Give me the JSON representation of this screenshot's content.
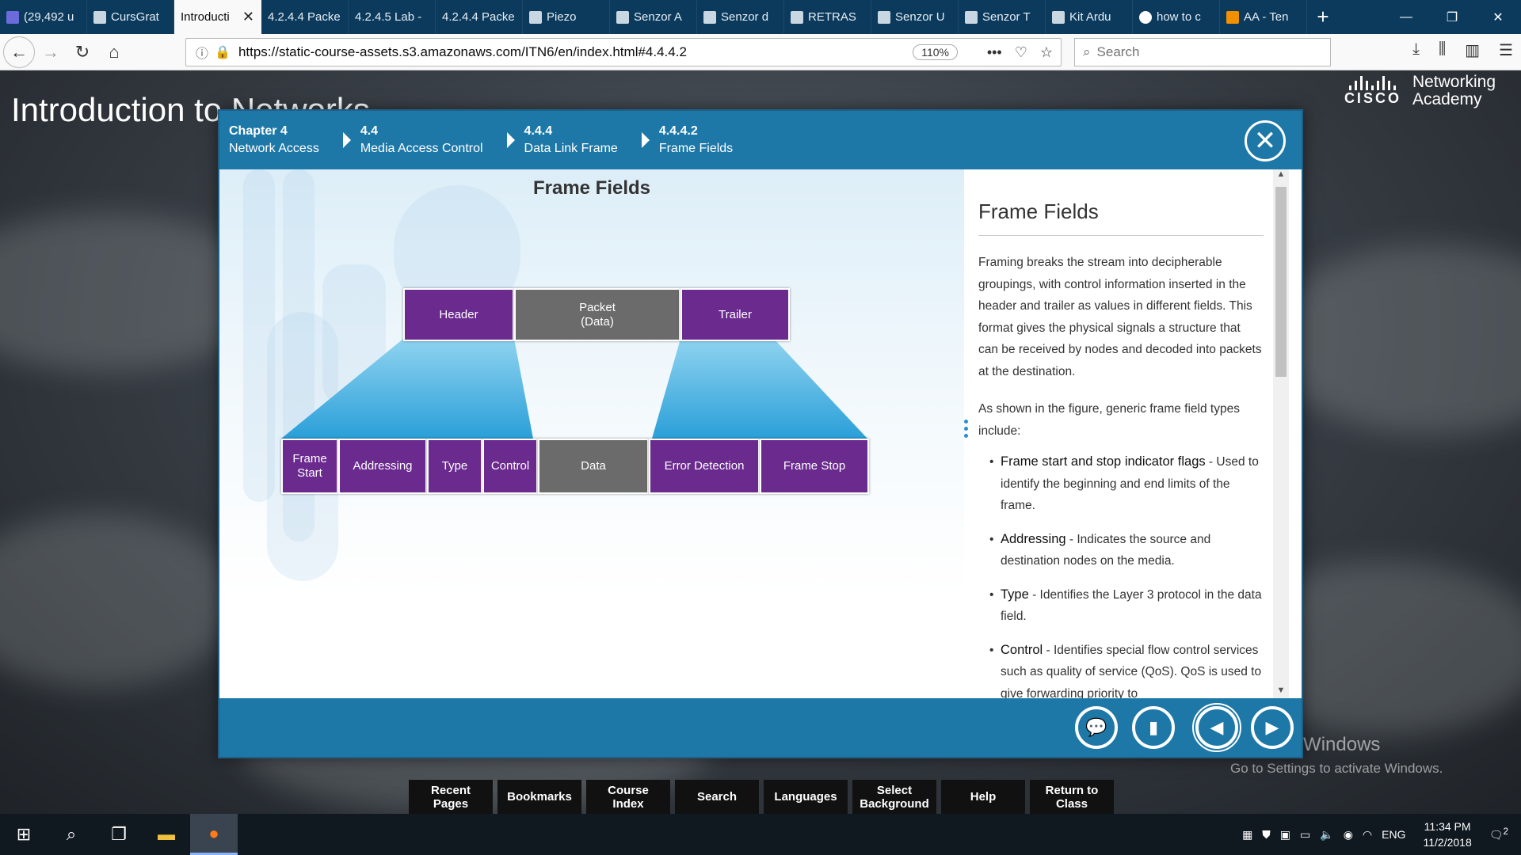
{
  "browser": {
    "tabs": [
      {
        "label": "(29,492 u",
        "icon": "mail-icon"
      },
      {
        "label": "CursGrat",
        "icon": "image-icon"
      },
      {
        "label": "Introducti",
        "icon": "none",
        "active": true
      },
      {
        "label": "4.2.4.4 Packe",
        "icon": "none"
      },
      {
        "label": "4.2.4.5 Lab -",
        "icon": "none"
      },
      {
        "label": "4.2.4.4 Packe",
        "icon": "none"
      },
      {
        "label": "Piezo",
        "icon": "image-icon"
      },
      {
        "label": "Senzor A",
        "icon": "image-icon"
      },
      {
        "label": "Senzor d",
        "icon": "image-icon"
      },
      {
        "label": "RETRAS",
        "icon": "image-icon"
      },
      {
        "label": "Senzor U",
        "icon": "image-icon"
      },
      {
        "label": "Senzor T",
        "icon": "image-icon"
      },
      {
        "label": "Kit Ardu",
        "icon": "image-icon"
      },
      {
        "label": "how to c",
        "icon": "google-icon"
      },
      {
        "label": "AA - Ten",
        "icon": "aa-icon"
      }
    ],
    "new_tab": "+",
    "url": "https://static-course-assets.s3.amazonaws.com/ITN6/en/index.html#4.4.4.2",
    "zoom": "110%",
    "search_placeholder": "Search"
  },
  "page": {
    "title": "Introduction to Networks",
    "brand_word": "CISCO",
    "brand_line1": "Networking",
    "brand_line2": "Academy",
    "activate_line1": "Activate Windows",
    "activate_line2": "Go to Settings to activate Windows."
  },
  "modal": {
    "breadcrumb": [
      {
        "num": "Chapter 4",
        "label": "Network Access"
      },
      {
        "num": "4.4",
        "label": "Media Access Control"
      },
      {
        "num": "4.4.4",
        "label": "Data Link Frame"
      },
      {
        "num": "4.4.4.2",
        "label": "Frame Fields"
      }
    ],
    "figure_title": "Frame Fields",
    "top_row": {
      "header": "Header",
      "packet_l1": "Packet",
      "packet_l2": "(Data)",
      "trailer": "Trailer"
    },
    "bottom_row": {
      "frame_start_l1": "Frame",
      "frame_start_l2": "Start",
      "addressing": "Addressing",
      "type": "Type",
      "control": "Control",
      "data": "Data",
      "error_detection": "Error Detection",
      "frame_stop": "Frame Stop"
    },
    "text": {
      "title": "Frame Fields",
      "p1": "Framing breaks the stream into decipherable groupings, with control information inserted in the header and trailer as values in different fields. This format gives the physical signals a structure that can be received by nodes and decoded into packets at the destination.",
      "p2": "As shown in the figure, generic frame field types include:",
      "items": [
        {
          "term": "Frame start and stop indicator flags",
          "desc": " - Used to identify the beginning and end limits of the frame."
        },
        {
          "term": "Addressing",
          "desc": " - Indicates the source and destination nodes on the media."
        },
        {
          "term": "Type",
          "desc": " - Identifies the Layer 3 protocol in the data field."
        },
        {
          "term": "Control",
          "desc": " - Identifies special flow control services such as quality of service (QoS). QoS is used to give forwarding priority to"
        }
      ]
    },
    "colors": {
      "header_blue": "#1d78a8",
      "field_purple": "#6a2a8e",
      "field_grey": "#6b6b6b"
    }
  },
  "course_toolbar": [
    {
      "l1": "Recent",
      "l2": "Pages"
    },
    {
      "l1": "Bookmarks",
      "l2": ""
    },
    {
      "l1": "Course",
      "l2": "Index"
    },
    {
      "l1": "Search",
      "l2": ""
    },
    {
      "l1": "Languages",
      "l2": ""
    },
    {
      "l1": "Select",
      "l2": "Background"
    },
    {
      "l1": "Help",
      "l2": ""
    },
    {
      "l1": "Return to",
      "l2": "Class"
    }
  ],
  "taskbar": {
    "lang": "ENG",
    "time": "11:34 PM",
    "date": "11/2/2018",
    "notifications": "2"
  }
}
